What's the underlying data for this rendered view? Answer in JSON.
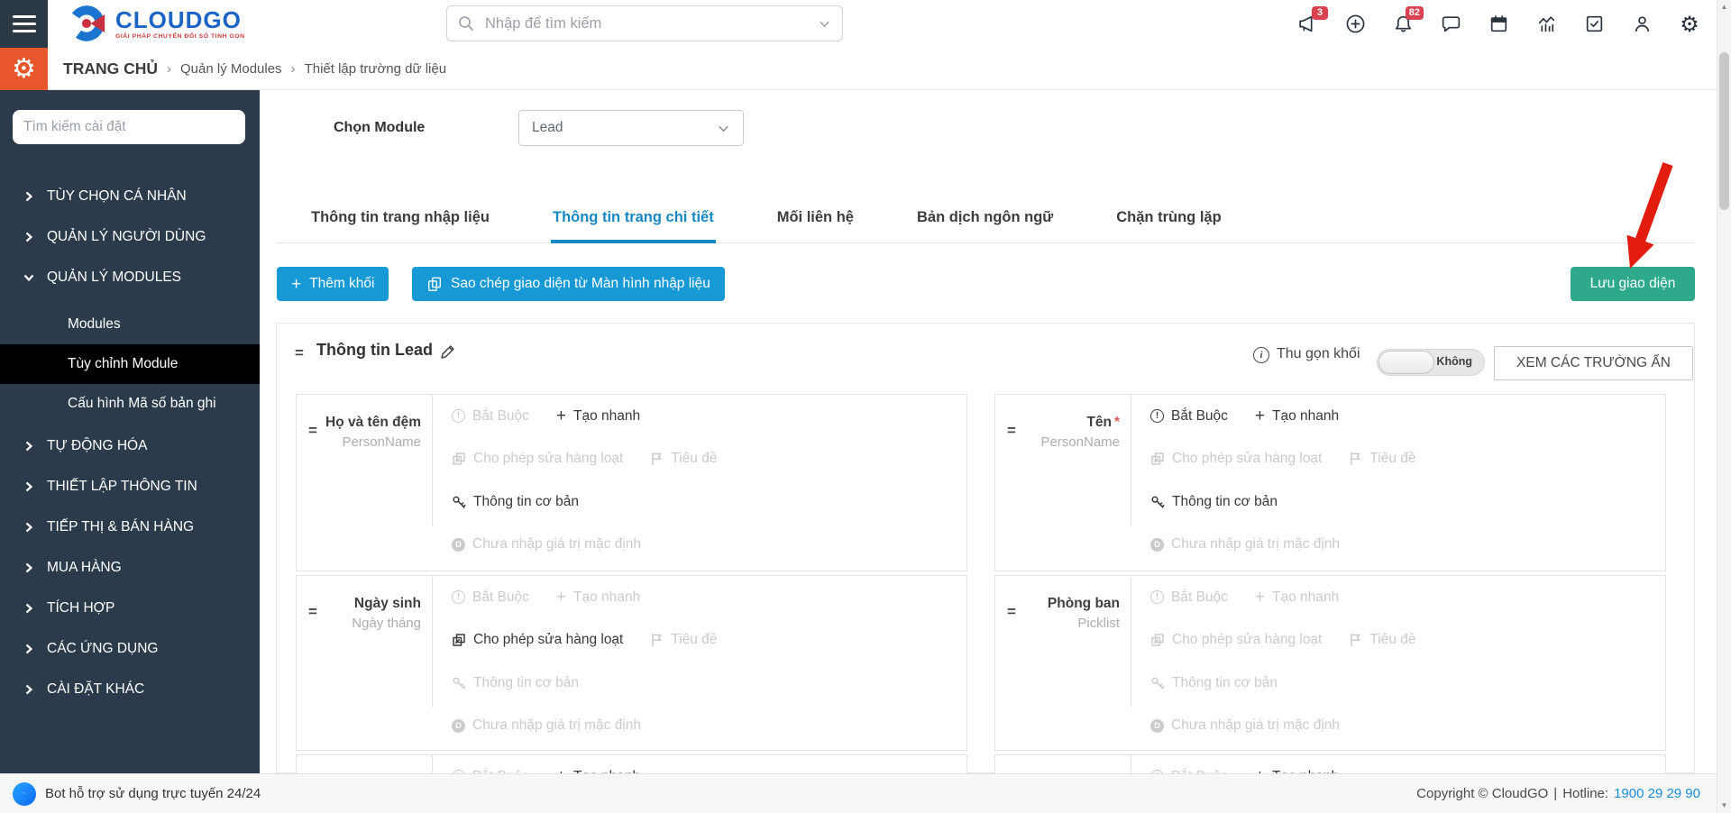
{
  "colors": {
    "accent_blue": "#1799d6",
    "tab_active_blue": "#1788c4",
    "save_green": "#2ea98b",
    "sidebar_navy": "#2c3b4b",
    "brand_orange": "#e8572b",
    "badge_red": "#d9414e",
    "arrow_red": "#e21d10",
    "hotline_blue": "#1a8cd8"
  },
  "topbar": {
    "logo": {
      "title": "CLOUDGO",
      "tagline": "GIẢI PHÁP CHUYỂN ĐỔI SỐ TINH GỌN"
    },
    "search_placeholder": "Nhập để tìm kiếm",
    "icons": [
      {
        "name": "megaphone-icon",
        "badge": "3"
      },
      {
        "name": "plus-circle-icon",
        "badge": ""
      },
      {
        "name": "bell-icon",
        "badge": "82"
      },
      {
        "name": "chat-icon",
        "badge": ""
      },
      {
        "name": "calendar-icon",
        "badge": ""
      },
      {
        "name": "analytics-icon",
        "badge": ""
      },
      {
        "name": "task-check-icon",
        "badge": ""
      },
      {
        "name": "user-icon",
        "badge": ""
      },
      {
        "name": "gear-icon",
        "badge": ""
      }
    ]
  },
  "breadcrumb": {
    "home": "TRANG CHỦ",
    "items": [
      "Quản lý Modules",
      "Thiết lập trường dữ liệu"
    ]
  },
  "sidebar": {
    "search_placeholder": "Tìm kiếm cài đặt",
    "items": [
      {
        "label": "TÙY CHỌN CÁ NHÂN",
        "expanded": false
      },
      {
        "label": "QUẢN LÝ NGƯỜI DÙNG",
        "expanded": false
      },
      {
        "label": "QUẢN LÝ MODULES",
        "expanded": true,
        "subitems": [
          {
            "label": "Modules",
            "active": false
          },
          {
            "label": "Tùy chỉnh Module",
            "active": true
          },
          {
            "label": "Cấu hình Mã số bản ghi",
            "active": false
          }
        ]
      },
      {
        "label": "TỰ ĐỘNG HÓA",
        "expanded": false
      },
      {
        "label": "THIẾT LẬP THÔNG TIN",
        "expanded": false
      },
      {
        "label": "TIẾP THỊ & BÁN HÀNG",
        "expanded": false
      },
      {
        "label": "MUA HÀNG",
        "expanded": false
      },
      {
        "label": "TÍCH HỢP",
        "expanded": false
      },
      {
        "label": "CÁC ỨNG DỤNG",
        "expanded": false
      },
      {
        "label": "CÀI ĐẶT KHÁC",
        "expanded": false
      }
    ]
  },
  "main": {
    "module_label": "Chọn Module",
    "module_value": "Lead",
    "tabs": [
      {
        "label": "Thông tin trang nhập liệu",
        "active": false
      },
      {
        "label": "Thông tin trang chi tiết",
        "active": true
      },
      {
        "label": "Mối liên hệ",
        "active": false
      },
      {
        "label": "Bản dịch ngôn ngữ",
        "active": false
      },
      {
        "label": "Chặn trùng lặp",
        "active": false
      }
    ],
    "buttons": {
      "add_block": "Thêm khối",
      "copy_layout": "Sao chép giao diện từ Màn hình nhập liệu",
      "save": "Lưu giao diện"
    },
    "block": {
      "title": "Thông tin Lead",
      "collapse_label": "Thu gọn khối",
      "collapse_value": "Không",
      "hidden_fields_button": "XEM CÁC TRƯỜNG ẨN"
    },
    "fields": {
      "required_asterisk": "*",
      "option_labels": {
        "required": "Bắt Buộc",
        "quick_create": "Tạo nhanh",
        "mass_edit": "Cho phép sửa hàng loạt",
        "header": "Tiêu đề",
        "key_field": "Thông tin cơ bản",
        "no_default": "Chưa nhập giá trị mặc định"
      },
      "cards": [
        {
          "name": "Họ và tên đệm",
          "type": "PersonName",
          "required": false,
          "states": {
            "required": false,
            "quick_create": true,
            "mass_edit": false,
            "header": false,
            "key_field": true,
            "no_default": false
          }
        },
        {
          "name": "Tên",
          "type": "PersonName",
          "required": true,
          "states": {
            "required": true,
            "quick_create": true,
            "mass_edit": false,
            "header": false,
            "key_field": true,
            "no_default": false
          }
        },
        {
          "name": "Ngày sinh",
          "type": "Ngày tháng",
          "required": false,
          "states": {
            "required": false,
            "quick_create": false,
            "mass_edit": true,
            "header": false,
            "key_field": false,
            "no_default": false
          }
        },
        {
          "name": "Phòng ban",
          "type": "Picklist",
          "required": false,
          "states": {
            "required": false,
            "quick_create": false,
            "mass_edit": false,
            "header": false,
            "key_field": false,
            "no_default": false
          }
        }
      ]
    }
  },
  "footer": {
    "bot_text": "Bot hỗ trợ sử dụng trực tuyến 24/24",
    "copyright": "Copyright © CloudGO",
    "divider": "|",
    "hotline_label": "Hotline:",
    "hotline_number": "1900 29 29 90"
  }
}
